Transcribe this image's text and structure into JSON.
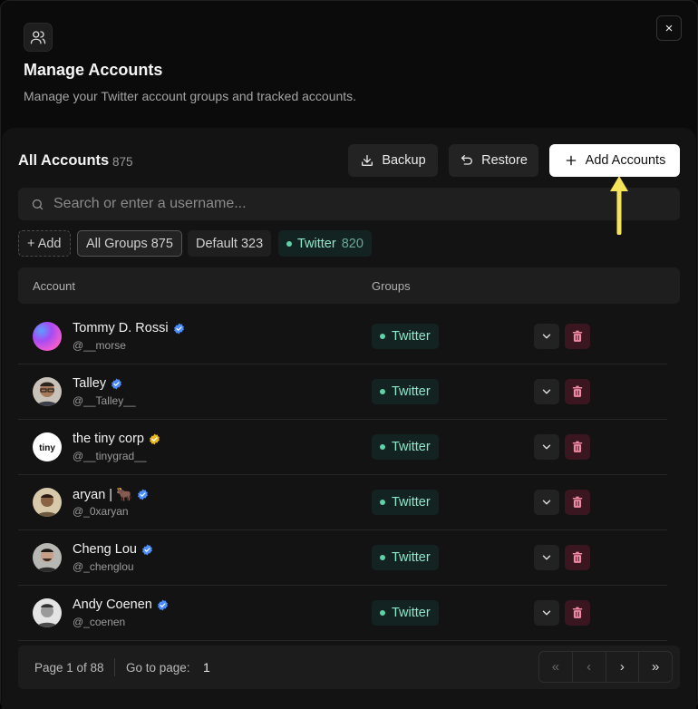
{
  "dialog": {
    "title": "Manage Accounts",
    "subtitle": "Manage your Twitter account groups and tracked accounts.",
    "close_icon": "×"
  },
  "section": {
    "title": "All Accounts",
    "count": "875"
  },
  "toolbar": {
    "backup_label": "Backup",
    "restore_label": "Restore",
    "add_accounts_label": "Add Accounts"
  },
  "search": {
    "placeholder": "Search or enter a username..."
  },
  "chips": {
    "add_label": "+ Add",
    "all_groups_label": "All Groups",
    "all_groups_count": "875",
    "default_label": "Default",
    "default_count": "323",
    "twitter_label": "Twitter",
    "twitter_count": "820"
  },
  "table": {
    "columns": [
      "Account",
      "Groups"
    ],
    "rows": [
      {
        "name": "Tommy D. Rossi",
        "handle": "@__morse",
        "verified": "blue",
        "group": "Twitter",
        "avatar": "gradient-purple"
      },
      {
        "name": "Talley",
        "handle": "@__Talley__",
        "verified": "blue",
        "group": "Twitter",
        "avatar": "photo-man-glasses"
      },
      {
        "name": "the tiny corp",
        "handle": "@__tinygrad__",
        "verified": "gold",
        "group": "Twitter",
        "avatar": "logo-tiny"
      },
      {
        "name": "aryan | 🐂",
        "handle": "@_0xaryan",
        "verified": "blue",
        "group": "Twitter",
        "avatar": "photo-man"
      },
      {
        "name": "Cheng Lou",
        "handle": "@_chenglou",
        "verified": "blue",
        "group": "Twitter",
        "avatar": "photo-man-beard"
      },
      {
        "name": "Andy Coenen",
        "handle": "@_coenen",
        "verified": "blue",
        "group": "Twitter",
        "avatar": "photo-man-bw"
      }
    ],
    "tiny_logo_text": "tiny"
  },
  "pagination": {
    "page_info": "Page 1 of 88",
    "goto_label": "Go to page:",
    "goto_value": "1",
    "first_icon": "«",
    "prev_icon": "‹",
    "next_icon": "›",
    "last_icon": "»"
  },
  "colors": {
    "accent_teal": "#5fd3a8",
    "verified_blue": "#4c8dff",
    "verified_gold": "#e8b923",
    "delete_bg": "#3a1620",
    "annotation_arrow": "#f5e35a"
  }
}
